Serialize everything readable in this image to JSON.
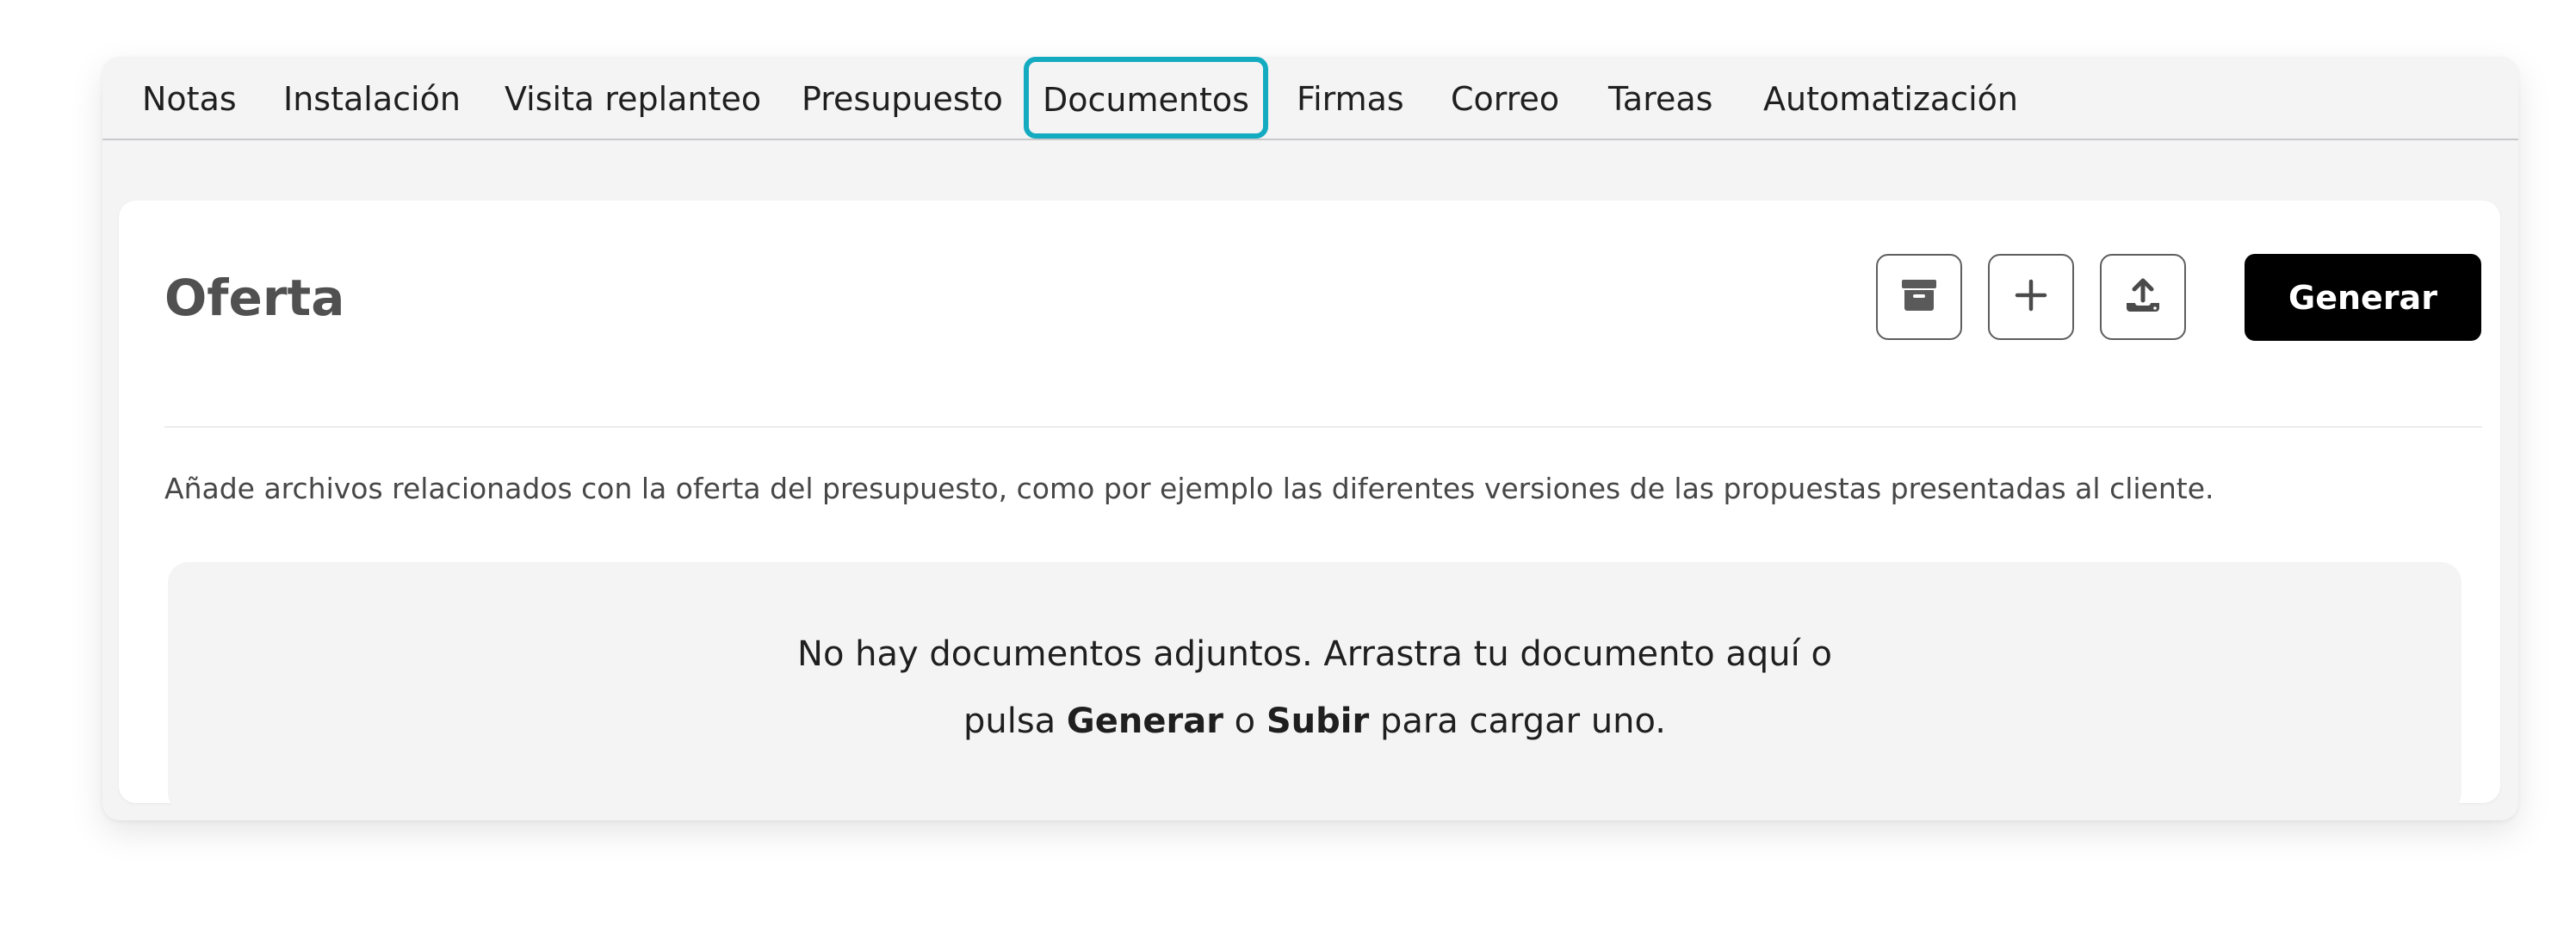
{
  "tabs": [
    {
      "label": "Notas"
    },
    {
      "label": "Instalación"
    },
    {
      "label": "Visita replanteo"
    },
    {
      "label": "Presupuesto"
    },
    {
      "label": "Documentos",
      "active": true
    },
    {
      "label": "Firmas"
    },
    {
      "label": "Correo"
    },
    {
      "label": "Tareas"
    },
    {
      "label": "Automatización"
    }
  ],
  "card": {
    "title": "Oferta",
    "actions": [
      {
        "icon": "archive-icon"
      },
      {
        "icon": "plus-icon"
      },
      {
        "icon": "upload-icon"
      }
    ],
    "primary_button": "Generar",
    "description": "Añade archivos relacionados con la oferta del presupuesto, como por ejemplo las diferentes versiones de las propuestas presentadas al cliente."
  },
  "dropzone": {
    "line1": "No hay documentos adjuntos. Arrastra tu documento aquí o",
    "line2_prefix": "pulsa",
    "line2_generate": "Generar",
    "line2_or": "o",
    "line2_upload": "Subir",
    "line2_suffix": "para cargar uno."
  },
  "colors": {
    "active_tab_border": "#14abc0",
    "primary_button_bg": "#000000",
    "panel_bg": "#f4f4f5"
  }
}
